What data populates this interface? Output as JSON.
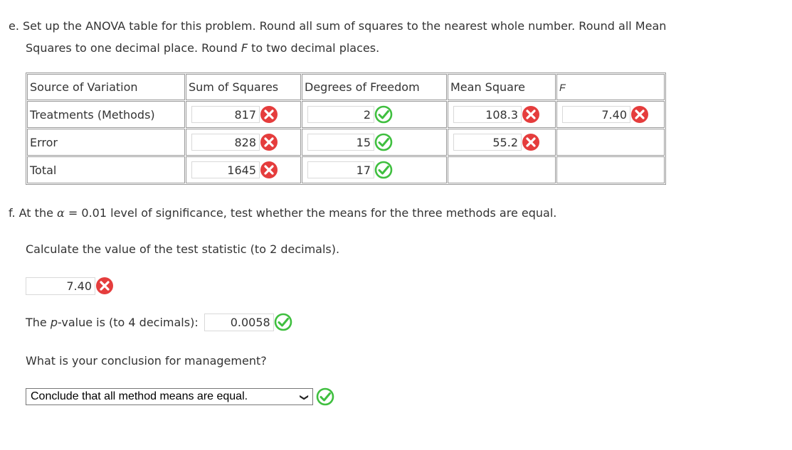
{
  "part_e": {
    "line1": "e. Set up the ANOVA table for this problem. Round all sum of squares to the nearest whole number. Round all Mean",
    "line2_a": "Squares to one decimal place. Round ",
    "line2_f": "F",
    "line2_b": " to two decimal places."
  },
  "table": {
    "headers": [
      "Source of Variation",
      "Sum of Squares",
      "Degrees of Freedom",
      "Mean Square",
      "F"
    ],
    "rows": [
      {
        "source": "Treatments (Methods)",
        "ss": "817",
        "ss_status": "wrong",
        "df": "2",
        "df_status": "correct",
        "ms": "108.3",
        "ms_status": "wrong",
        "f": "7.40",
        "f_status": "wrong"
      },
      {
        "source": "Error",
        "ss": "828",
        "ss_status": "wrong",
        "df": "15",
        "df_status": "correct",
        "ms": "55.2",
        "ms_status": "wrong"
      },
      {
        "source": "Total",
        "ss": "1645",
        "ss_status": "wrong",
        "df": "17",
        "df_status": "correct"
      }
    ]
  },
  "part_f": {
    "intro_a": "f. At the ",
    "alpha": "α",
    "intro_b": " = 0.01 level of significance, test whether the means for the three methods are equal.",
    "calc_prompt": "Calculate the value of the test statistic (to 2 decimals).",
    "test_statistic": "7.40",
    "test_statistic_status": "wrong",
    "pvalue_a": "The ",
    "pvalue_p": "p",
    "pvalue_b": "-value is (to 4 decimals):",
    "pvalue": "0.0058",
    "pvalue_status": "correct",
    "conclusion_prompt": "What is your conclusion for management?",
    "conclusion_selected": "Conclude that all method means are equal.",
    "conclusion_status": "correct"
  },
  "icons": {
    "wrong": "x-circle-icon",
    "correct": "check-circle-icon",
    "wrong_color": "#e53d3d",
    "correct_color": "#3fbf3f"
  }
}
